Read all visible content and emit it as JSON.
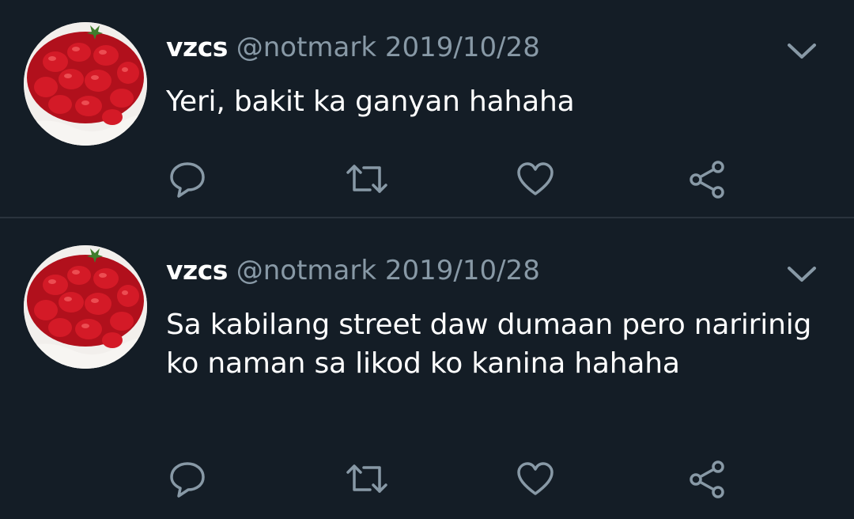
{
  "colors": {
    "background": "#141d26",
    "divider": "#2a333d",
    "secondary_text": "#8899a6",
    "icon": "#8899a6"
  },
  "tweets": [
    {
      "name": "vzcs",
      "handle": "@notmark",
      "date": "2019/10/28",
      "text": "Yeri, bakit ka ganyan hahaha"
    },
    {
      "name": "vzcs",
      "handle": "@notmark",
      "date": "2019/10/28",
      "text": "Sa kabilang street daw dumaan pero naririnig ko naman sa likod ko kanina hahaha"
    }
  ],
  "icons": {
    "avatar": "strawberry-cake-photo",
    "menu": "chevron-down-icon",
    "reply": "reply-bubble-icon",
    "retweet": "retweet-icon",
    "like": "heart-icon",
    "share": "share-icon"
  }
}
